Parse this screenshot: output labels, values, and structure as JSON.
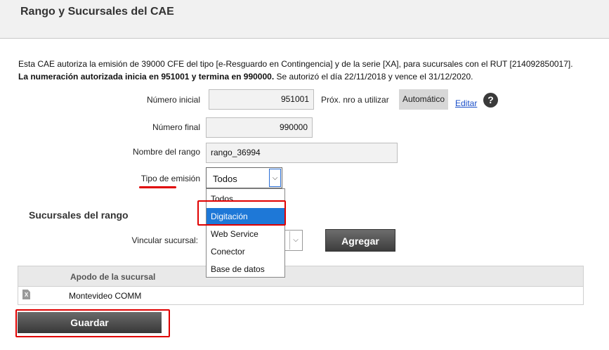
{
  "header": {
    "title": "Rango y Sucursales del CAE"
  },
  "description": {
    "line1": "Esta CAE autoriza la emisión de 39000 CFE del tipo [e-Resguardo en Contingencia] y de la serie [XA], para sucursales con el RUT [214092850017].",
    "line2_bold": "La numeración autorizada inicia en 951001 y termina en 990000.",
    "line2_rest": " Se autorizó el día 22/11/2018 y vence el 31/12/2020."
  },
  "form": {
    "numero_inicial_label": "Número inicial",
    "numero_inicial_value": "951001",
    "prox_label": "Próx. nro a utilizar",
    "automatico_label": "Automático",
    "editar_label": "Editar",
    "help_glyph": "?",
    "numero_final_label": "Número final",
    "numero_final_value": "990000",
    "nombre_rango_label": "Nombre del rango",
    "nombre_rango_value": "rango_36994",
    "tipo_emision_label": "Tipo de emisión",
    "tipo_emision_value": "Todos",
    "tipo_emision_options": [
      "Todos",
      "Digitación",
      "Web Service",
      "Conector",
      "Base de datos"
    ]
  },
  "sucursales": {
    "title": "Sucursales del rango",
    "vincular_label": "Vincular sucursal:",
    "agregar_label": "Agregar",
    "table_header": "Apodo de la sucursal",
    "rows": [
      {
        "apodo": "Montevideo COMM"
      }
    ]
  },
  "guardar_label": "Guardar",
  "icons": {
    "dropdown": "chevron-down-icon",
    "help": "help-icon",
    "doc": "excel-file-icon"
  },
  "colors": {
    "accent": "#1e78d7",
    "highlight": "#e00000"
  }
}
